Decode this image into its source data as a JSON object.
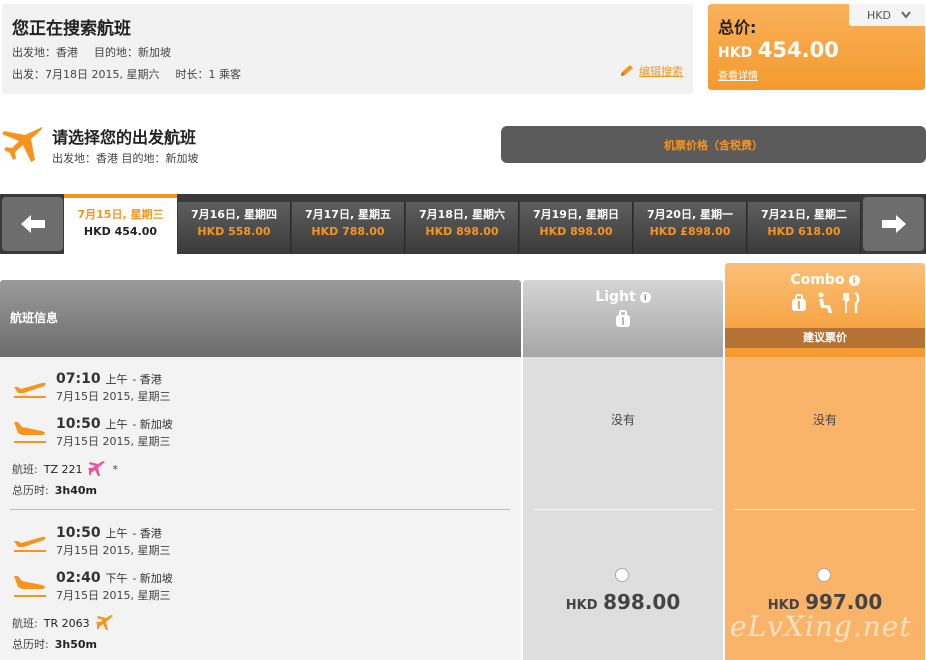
{
  "search": {
    "title": "您正在搜索航班",
    "origin_label": "出发地：香港",
    "destination_label": "目的地：新加坡",
    "depart_label": "出发：",
    "depart_date": "7月18日 2015, 星期六",
    "duration_label": "时长：",
    "passengers": "1 乘客",
    "edit_link": "编辑搜索"
  },
  "total": {
    "label": "总价:",
    "currency": "HKD",
    "amount": "454.00",
    "details_link": "查看详情",
    "currency_selector": "HKD"
  },
  "departure": {
    "title": "请选择您的出发航班",
    "subtitle": "出发地：香港 目的地：新加坡",
    "fare_header": "机票价格（含税费）"
  },
  "dates": [
    {
      "date": "7月15日, 星期三",
      "price": "HKD 454.00",
      "selected": true
    },
    {
      "date": "7月16日, 星期四",
      "price": "HKD 558.00",
      "selected": false
    },
    {
      "date": "7月17日, 星期五",
      "price": "HKD 788.00",
      "selected": false
    },
    {
      "date": "7月18日, 星期六",
      "price": "HKD 898.00",
      "selected": false
    },
    {
      "date": "7月19日, 星期日",
      "price": "HKD 898.00",
      "selected": false
    },
    {
      "date": "7月20日, 星期一",
      "price": "HKD £898.00",
      "selected": false
    },
    {
      "date": "7月21日, 星期二",
      "price": "HKD 618.00",
      "selected": false
    }
  ],
  "table": {
    "info_header": "航班信息",
    "light_name": "Light",
    "combo_name": "Combo",
    "recommended": "建议票价",
    "info_icon": "i"
  },
  "flights": [
    {
      "dep_time": "07:10",
      "dep_ampm": "上午",
      "dep_place": "- 香港",
      "dep_date": "7月15日 2015, 星期三",
      "arr_time": "10:50",
      "arr_ampm": "上午",
      "arr_place": "- 新加坡",
      "arr_date": "7月15日 2015, 星期三",
      "flight_label": "航班:",
      "flight_no": "TZ 221",
      "flight_mark": "*",
      "duration_label": "总历时:",
      "duration": "3h40m",
      "light_status": "没有",
      "combo_status": "没有"
    },
    {
      "dep_time": "10:50",
      "dep_ampm": "上午",
      "dep_place": "- 香港",
      "dep_date": "7月15日 2015, 星期三",
      "arr_time": "02:40",
      "arr_ampm": "下午",
      "arr_place": "- 新加坡",
      "arr_date": "7月15日 2015, 星期三",
      "flight_label": "航班:",
      "flight_no": "TR 2063",
      "duration_label": "总历时:",
      "duration": "3h50m",
      "light_currency": "HKD",
      "light_price": "898.00",
      "combo_currency": "HKD",
      "combo_price": "997.00"
    }
  ],
  "watermark": "eLvXing.net",
  "colors": {
    "accent": "#f7941d",
    "dark_strip": "#3a3a3a",
    "combo": "#fab46a",
    "light": "#dedede",
    "scoot_pink": "#e8579b"
  }
}
